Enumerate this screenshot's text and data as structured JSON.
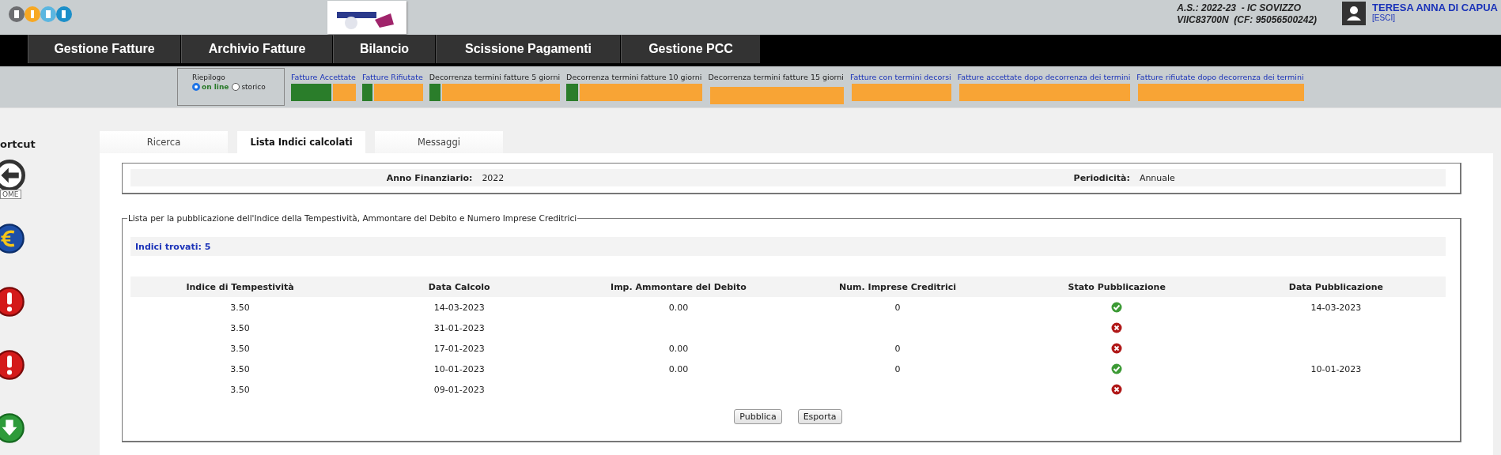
{
  "header": {
    "school_line": "A.S.: 2022-23  - IC SOVIZZO",
    "code_line": "VIIC83700N  (CF: 95056500242)",
    "user_name": "TERESA ANNA DI CAPUA",
    "logout": "[ESCI]"
  },
  "nav": [
    "Gestione Fatture",
    "Archivio Fatture",
    "Bilancio",
    "Scissione Pagamenti",
    "Gestione PCC"
  ],
  "summary": {
    "title": "Riepilogo",
    "modes": [
      {
        "label": "on line",
        "selected": true
      },
      {
        "label": "storico",
        "selected": false
      }
    ],
    "items": [
      {
        "label": "Fatture Accettate",
        "link": true,
        "level": 0.65
      },
      {
        "label": "Fatture Rifiutate",
        "link": true,
        "level": 0.2
      },
      {
        "label": "Decorrenza termini fatture 5 giorni",
        "link": false,
        "level": 0.1
      },
      {
        "label": "Decorrenza termini fatture 10 giorni",
        "link": false,
        "level": 0.1
      },
      {
        "label": "Decorrenza termini fatture 15 giorni",
        "link": false,
        "level": 0
      },
      {
        "label": "Fatture con termini decorsi",
        "link": true,
        "level": 0
      },
      {
        "label": "Fatture accettate dopo decorrenza dei termini",
        "link": true,
        "level": 0
      },
      {
        "label": "Fatture rifiutate dopo decorrenza dei termini",
        "link": true,
        "level": 0
      }
    ]
  },
  "sidebar": {
    "title": "ortcut",
    "items": [
      {
        "kind": "home",
        "label": "OME"
      },
      {
        "kind": "euro"
      },
      {
        "kind": "alert"
      },
      {
        "kind": "alert"
      },
      {
        "kind": "download"
      }
    ]
  },
  "tabs": [
    {
      "label": "Ricerca",
      "selected": false
    },
    {
      "label": "Lista Indici calcolati",
      "selected": true
    },
    {
      "label": "Messaggi",
      "selected": false
    }
  ],
  "filters": [
    {
      "label": "Anno Finanziario:",
      "value": "2022"
    },
    {
      "label": "Periodicità:",
      "value": "Annuale"
    }
  ],
  "list": {
    "legend": "Lista per la pubblicazione dell'Indice della Tempestività, Ammontare del Debito e Numero Imprese Creditrici",
    "count": "Indici trovati: 5",
    "columns": [
      "Indice di Tempestività",
      "Data Calcolo",
      "Imp. Ammontare del Debito",
      "Num. Imprese Creditrici",
      "Stato Pubblicazione",
      "Data Pubblicazione"
    ],
    "rows": [
      {
        "index": "3.50",
        "date": "14-03-2023",
        "debt": "0.00",
        "firms": "0",
        "published": true,
        "pub_date": "14-03-2023"
      },
      {
        "index": "3.50",
        "date": "31-01-2023",
        "published": false
      },
      {
        "index": "3.50",
        "date": "17-01-2023",
        "debt": "0.00",
        "firms": "0",
        "published": false
      },
      {
        "index": "3.50",
        "date": "10-01-2023",
        "debt": "0.00",
        "firms": "0",
        "published": true,
        "pub_date": "10-01-2023"
      },
      {
        "index": "3.50",
        "date": "09-01-2023",
        "published": false
      }
    ],
    "buttons": [
      "Pubblica",
      "Esporta"
    ]
  }
}
